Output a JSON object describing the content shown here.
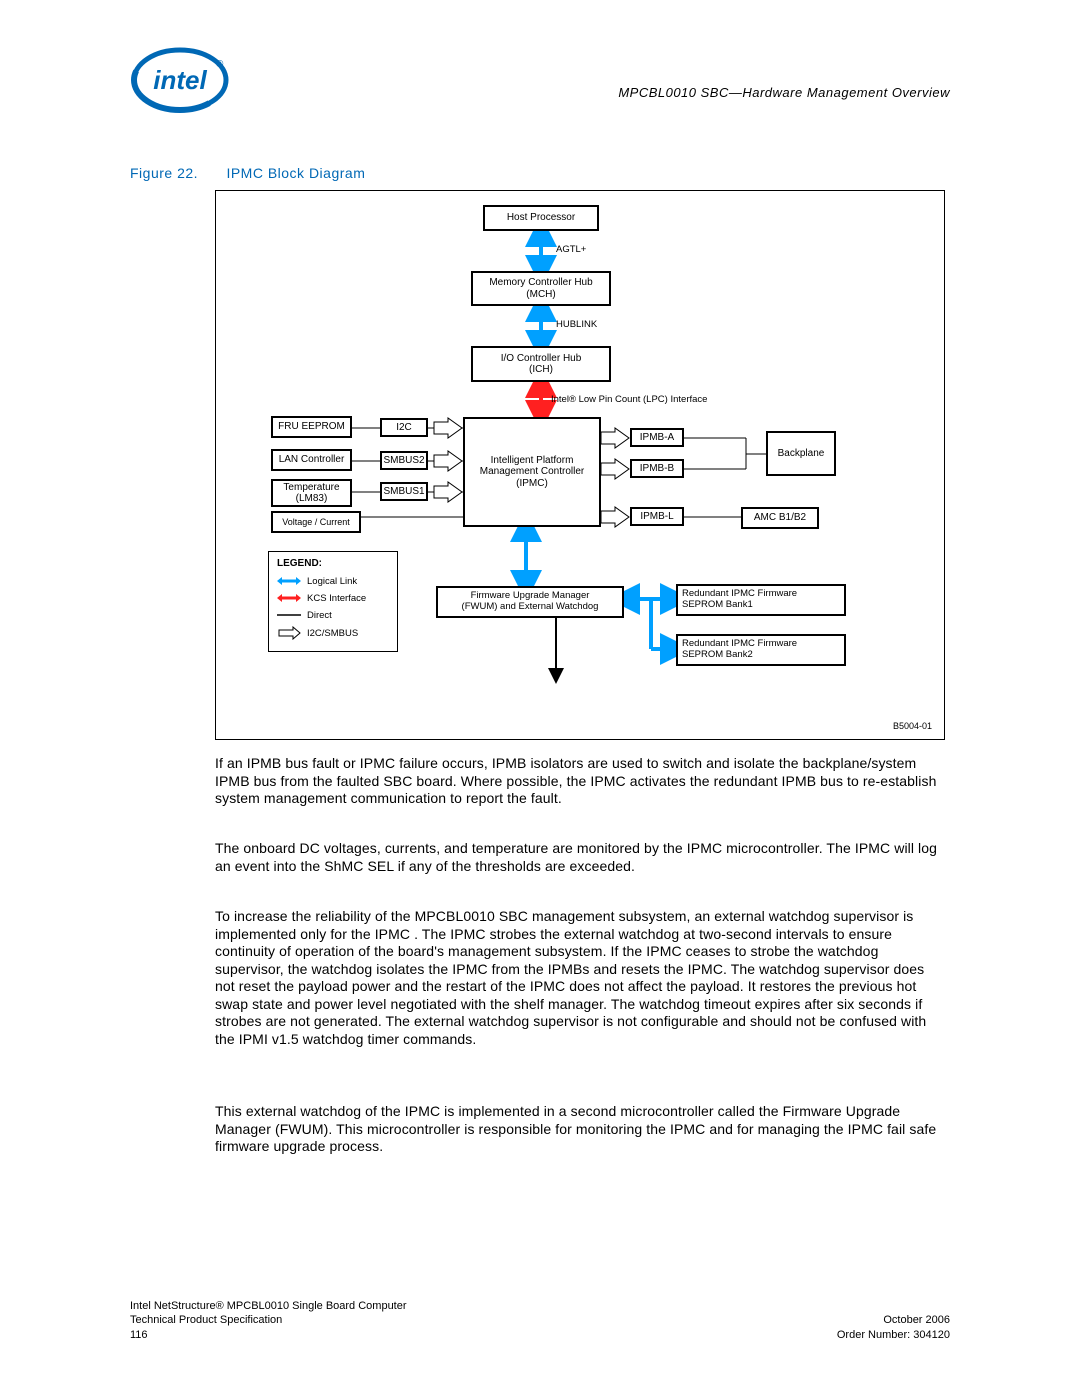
{
  "header": {
    "doc_title": "MPCBL0010 SBC—Hardware Management Overview"
  },
  "figure": {
    "label": "Figure 22.",
    "title": "IPMC Block Diagram",
    "id": "B5004-01"
  },
  "diagram": {
    "host_processor": "Host Processor",
    "agtl": "AGTL+",
    "mch": "Memory Controller Hub\n(MCH)",
    "hublink": "HUBLINK",
    "ich": "I/O Controller Hub\n(ICH)",
    "lpc": "Intel® Low Pin Count (LPC) Interface",
    "fru_eeprom": "FRU EEPROM",
    "i2c": "I2C",
    "lan_ctrl": "LAN Controller",
    "smbus2": "SMBUS2",
    "temp": "Temperature\n(LM83)",
    "smbus1": "SMBUS1",
    "volt_curr": "Voltage / Current",
    "ipmc": "Intelligent Platform\nManagement Controller\n(IPMC)",
    "ipmb_a": "IPMB-A",
    "ipmb_b": "IPMB-B",
    "backplane": "Backplane",
    "ipmb_l": "IPMB-L",
    "amc": "AMC B1/B2",
    "fwum": "Firmware Upgrade Manager\n(FWUM) and External Watchdog",
    "seprom1": "Redundant IPMC Firmware\nSEPROM Bank1",
    "seprom2": "Redundant IPMC Firmware\nSEPROM Bank2",
    "legend": {
      "title": "LEGEND:",
      "logical": "Logical Link",
      "kcs": "KCS Interface",
      "direct": "Direct",
      "i2c_smbus": "I2C/SMBUS"
    }
  },
  "paragraphs": {
    "p1": "If an IPMB bus fault or IPMC failure occurs, IPMB isolators are used to switch and isolate the backplane/system IPMB bus from the faulted SBC board. Where possible, the IPMC activates the redundant IPMB bus to re-establish system management communication to report the fault.",
    "p2": "The onboard DC voltages, currents, and temperature are monitored by the IPMC microcontroller. The IPMC will log an event into the ShMC SEL if any of the thresholds are exceeded.",
    "p3": "To increase the reliability of the MPCBL0010 SBC management subsystem, an external watchdog supervisor is implemented only for the IPMC . The IPMC strobes the external watchdog at two-second intervals to ensure continuity of operation of the board's management subsystem. If the IPMC ceases to strobe the watchdog supervisor, the watchdog isolates the IPMC from the IPMBs and resets the IPMC. The watchdog supervisor does not reset the payload power and the restart of the IPMC does not affect the payload. It restores the previous hot swap state and power level negotiated with the shelf manager. The watchdog timeout expires after six seconds if strobes are not generated. The external watchdog supervisor is not configurable and should not be confused with the IPMI v1.5 watchdog timer commands.",
    "p4": "This external watchdog of the IPMC is implemented in a second microcontroller called the Firmware Upgrade Manager (FWUM). This microcontroller is responsible for monitoring the IPMC and for managing the IPMC fail safe firmware upgrade process."
  },
  "footer": {
    "product": "Intel NetStructure® MPCBL0010 Single Board Computer",
    "doc_type": "Technical Product Specification",
    "page": "116",
    "date": "October 2006",
    "order": "Order Number: 304120"
  }
}
